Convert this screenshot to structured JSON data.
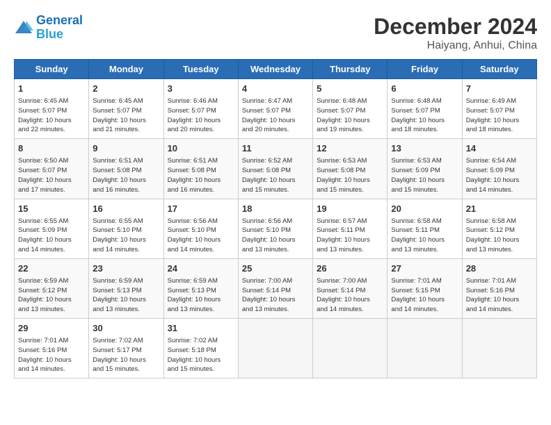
{
  "header": {
    "logo_line1": "General",
    "logo_line2": "Blue",
    "month": "December 2024",
    "location": "Haiyang, Anhui, China"
  },
  "weekdays": [
    "Sunday",
    "Monday",
    "Tuesday",
    "Wednesday",
    "Thursday",
    "Friday",
    "Saturday"
  ],
  "weeks": [
    [
      {
        "day": "1",
        "info": "Sunrise: 6:45 AM\nSunset: 5:07 PM\nDaylight: 10 hours\nand 22 minutes."
      },
      {
        "day": "2",
        "info": "Sunrise: 6:45 AM\nSunset: 5:07 PM\nDaylight: 10 hours\nand 21 minutes."
      },
      {
        "day": "3",
        "info": "Sunrise: 6:46 AM\nSunset: 5:07 PM\nDaylight: 10 hours\nand 20 minutes."
      },
      {
        "day": "4",
        "info": "Sunrise: 6:47 AM\nSunset: 5:07 PM\nDaylight: 10 hours\nand 20 minutes."
      },
      {
        "day": "5",
        "info": "Sunrise: 6:48 AM\nSunset: 5:07 PM\nDaylight: 10 hours\nand 19 minutes."
      },
      {
        "day": "6",
        "info": "Sunrise: 6:48 AM\nSunset: 5:07 PM\nDaylight: 10 hours\nand 18 minutes."
      },
      {
        "day": "7",
        "info": "Sunrise: 6:49 AM\nSunset: 5:07 PM\nDaylight: 10 hours\nand 18 minutes."
      }
    ],
    [
      {
        "day": "8",
        "info": "Sunrise: 6:50 AM\nSunset: 5:07 PM\nDaylight: 10 hours\nand 17 minutes."
      },
      {
        "day": "9",
        "info": "Sunrise: 6:51 AM\nSunset: 5:08 PM\nDaylight: 10 hours\nand 16 minutes."
      },
      {
        "day": "10",
        "info": "Sunrise: 6:51 AM\nSunset: 5:08 PM\nDaylight: 10 hours\nand 16 minutes."
      },
      {
        "day": "11",
        "info": "Sunrise: 6:52 AM\nSunset: 5:08 PM\nDaylight: 10 hours\nand 15 minutes."
      },
      {
        "day": "12",
        "info": "Sunrise: 6:53 AM\nSunset: 5:08 PM\nDaylight: 10 hours\nand 15 minutes."
      },
      {
        "day": "13",
        "info": "Sunrise: 6:53 AM\nSunset: 5:09 PM\nDaylight: 10 hours\nand 15 minutes."
      },
      {
        "day": "14",
        "info": "Sunrise: 6:54 AM\nSunset: 5:09 PM\nDaylight: 10 hours\nand 14 minutes."
      }
    ],
    [
      {
        "day": "15",
        "info": "Sunrise: 6:55 AM\nSunset: 5:09 PM\nDaylight: 10 hours\nand 14 minutes."
      },
      {
        "day": "16",
        "info": "Sunrise: 6:55 AM\nSunset: 5:10 PM\nDaylight: 10 hours\nand 14 minutes."
      },
      {
        "day": "17",
        "info": "Sunrise: 6:56 AM\nSunset: 5:10 PM\nDaylight: 10 hours\nand 14 minutes."
      },
      {
        "day": "18",
        "info": "Sunrise: 6:56 AM\nSunset: 5:10 PM\nDaylight: 10 hours\nand 13 minutes."
      },
      {
        "day": "19",
        "info": "Sunrise: 6:57 AM\nSunset: 5:11 PM\nDaylight: 10 hours\nand 13 minutes."
      },
      {
        "day": "20",
        "info": "Sunrise: 6:58 AM\nSunset: 5:11 PM\nDaylight: 10 hours\nand 13 minutes."
      },
      {
        "day": "21",
        "info": "Sunrise: 6:58 AM\nSunset: 5:12 PM\nDaylight: 10 hours\nand 13 minutes."
      }
    ],
    [
      {
        "day": "22",
        "info": "Sunrise: 6:59 AM\nSunset: 5:12 PM\nDaylight: 10 hours\nand 13 minutes."
      },
      {
        "day": "23",
        "info": "Sunrise: 6:59 AM\nSunset: 5:13 PM\nDaylight: 10 hours\nand 13 minutes."
      },
      {
        "day": "24",
        "info": "Sunrise: 6:59 AM\nSunset: 5:13 PM\nDaylight: 10 hours\nand 13 minutes."
      },
      {
        "day": "25",
        "info": "Sunrise: 7:00 AM\nSunset: 5:14 PM\nDaylight: 10 hours\nand 13 minutes."
      },
      {
        "day": "26",
        "info": "Sunrise: 7:00 AM\nSunset: 5:14 PM\nDaylight: 10 hours\nand 14 minutes."
      },
      {
        "day": "27",
        "info": "Sunrise: 7:01 AM\nSunset: 5:15 PM\nDaylight: 10 hours\nand 14 minutes."
      },
      {
        "day": "28",
        "info": "Sunrise: 7:01 AM\nSunset: 5:16 PM\nDaylight: 10 hours\nand 14 minutes."
      }
    ],
    [
      {
        "day": "29",
        "info": "Sunrise: 7:01 AM\nSunset: 5:16 PM\nDaylight: 10 hours\nand 14 minutes."
      },
      {
        "day": "30",
        "info": "Sunrise: 7:02 AM\nSunset: 5:17 PM\nDaylight: 10 hours\nand 15 minutes."
      },
      {
        "day": "31",
        "info": "Sunrise: 7:02 AM\nSunset: 5:18 PM\nDaylight: 10 hours\nand 15 minutes."
      },
      null,
      null,
      null,
      null
    ]
  ]
}
